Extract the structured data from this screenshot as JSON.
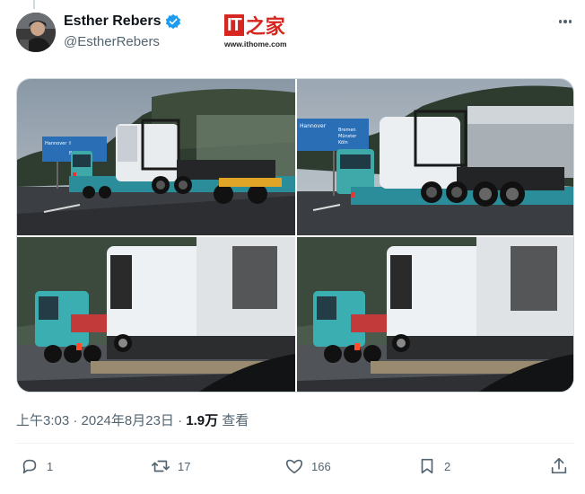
{
  "tweet": {
    "author_name": "Esther Rebers",
    "author_handle": "@EstherRebers",
    "timestamp": "上午3:03 · 2024年8月23日",
    "views_count": "1.9万",
    "views_label": "查看"
  },
  "watermark": {
    "logo_it": "IT",
    "logo_home": "之家",
    "url": "www.ithome.com"
  },
  "road_sign": {
    "line1": "Hannover",
    "line2": "Bremen",
    "line3": "Münster",
    "line4": "Köln"
  },
  "actions": {
    "replies": "1",
    "reposts": "17",
    "likes": "166",
    "bookmarks": "2"
  },
  "colors": {
    "verified": "#1d9bf0",
    "text_primary": "#0f1419",
    "text_secondary": "#536471",
    "watermark_red": "#d7261f"
  },
  "icons": [
    "verified-badge-icon",
    "more-icon",
    "reply-icon",
    "retweet-icon",
    "like-icon",
    "bookmark-icon",
    "share-icon"
  ]
}
